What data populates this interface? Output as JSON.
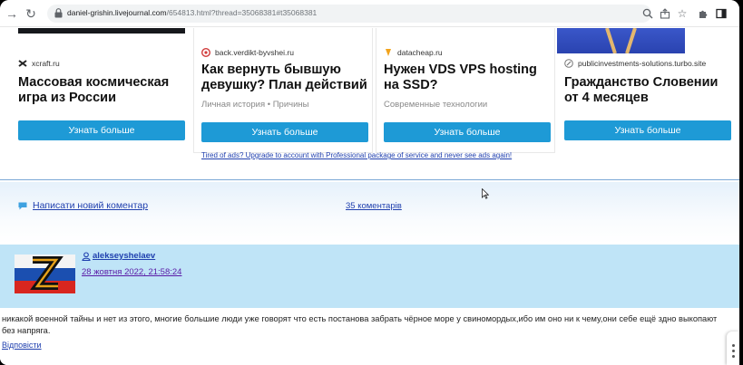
{
  "browser": {
    "url_host": "daniel-grishin.livejournal.com",
    "url_path": "/654813.html?thread=35068381#t35068381",
    "back_icon": "arrow-left-icon",
    "reload_icon": "reload-icon",
    "zoom_icon": "zoom-icon",
    "share_icon": "share-icon",
    "star_icon": "star-icon",
    "extensions_icon": "puzzle-icon",
    "sidepanel_icon": "side-panel-icon"
  },
  "ads": {
    "cards": [
      {
        "source": "xcraft.ru",
        "title": "Массовая космическая игра из России",
        "subtitle": "",
        "button": "Узнать больше"
      },
      {
        "source": "back.verdikt-byvshei.ru",
        "title": "Как вернуть бывшую девушку? План действий",
        "subtitle": "Личная история • Причины",
        "button": "Узнать больше"
      },
      {
        "source": "datacheap.ru",
        "title": "Нужен VDS VPS hosting на SSD?",
        "subtitle": "Современные технологии",
        "button": "Узнать больше"
      },
      {
        "source": "publicinvestments-solutions.turbo.site",
        "title": "Гражданство Словении от 4 месяцев",
        "subtitle": "",
        "button": "Узнать больше"
      }
    ],
    "upgrade_text": "Tired of ads? Upgrade to account with Professional package of service and never see ads again!"
  },
  "comments": {
    "add_comment": "Написати новий коментар",
    "count": "35 коментарів"
  },
  "comment": {
    "username": "alekseyshelaev",
    "date": "28 жовтня 2022, 21:58:24",
    "text": "никакой военной тайны и нет из этого, многие большие люди уже говорят что есть постанова забрать чёрное море у свиномордых,ибо им оно ни к чему,они себе ещё здно выкопают без напряга.",
    "reply": "Відповісти"
  },
  "colors": {
    "accent_button": "#1e9ad6",
    "link": "#1f3fae",
    "visited_link": "#5a1aa6",
    "comment_header_bg": "#bfe4f7"
  }
}
